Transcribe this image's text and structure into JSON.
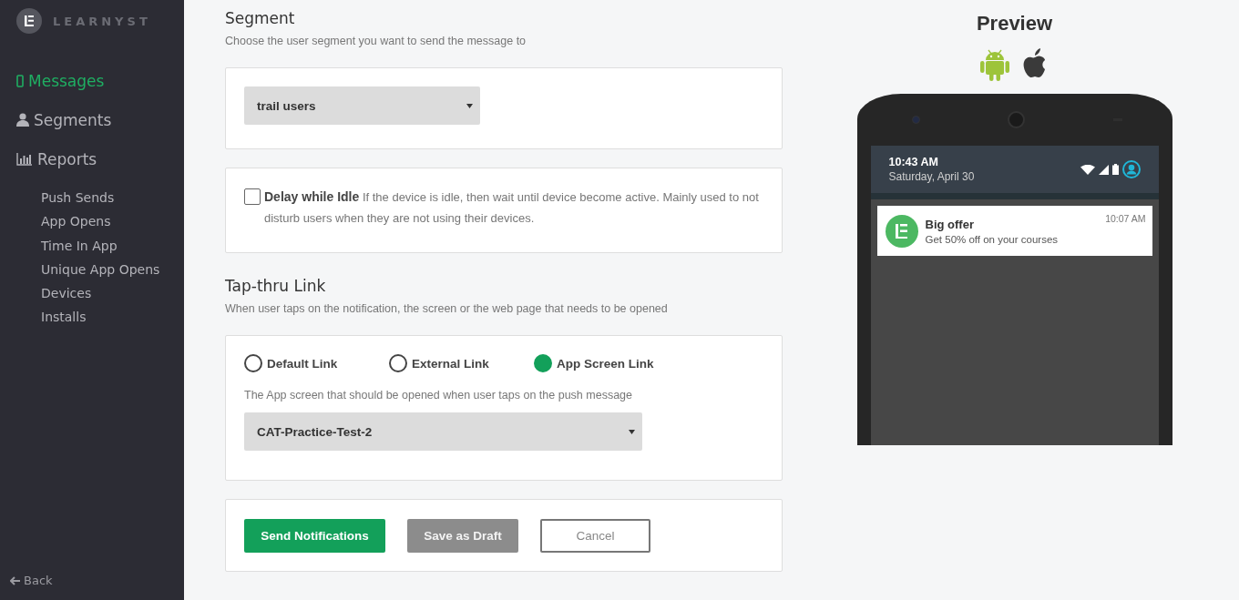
{
  "sidebar": {
    "logo": "LEARNYST",
    "items": [
      {
        "label": "Messages",
        "kind": "phone",
        "selected": true
      },
      {
        "label": "Segments",
        "kind": "user",
        "selected": false
      },
      {
        "label": "Reports",
        "kind": "chart",
        "selected": false
      }
    ],
    "sub_items": [
      "Push Sends",
      "App Opens",
      "Time In App",
      "Unique App Opens",
      "Devices",
      "Installs"
    ],
    "back": "Back"
  },
  "segment": {
    "title": "Segment",
    "hint": "Choose the user segment you want to send the message to",
    "value": "trail users"
  },
  "delay": {
    "checked": false,
    "text": "**Delay while Idle** If the device is idle, then wait until device become active. Mainly used to not disturb users when they are not using their devices."
  },
  "tap_thru": {
    "title": "Tap-thru Link",
    "hint": "When user taps on the notification, the screen or the web page that needs to be opened",
    "options": [
      {
        "label": "Default Link",
        "selected": false
      },
      {
        "label": "External Link",
        "selected": false
      },
      {
        "label": "App Screen Link",
        "selected": true
      }
    ],
    "screen_hint": "The App screen that should be opened when user taps on the push message",
    "screen_value": "CAT-Practice-Test-2"
  },
  "buttons": [
    {
      "label": "Send Notifications",
      "kind": "primary"
    },
    {
      "label": "Save as Draft",
      "kind": "secondary"
    },
    {
      "label": "Cancel",
      "kind": "outline"
    }
  ],
  "preview": {
    "title": "Preview",
    "time": "10:43 AM",
    "date": "Saturday, April 30",
    "notification": {
      "title": "Big offer",
      "body": "Get 50% off on your courses",
      "time": "10:07 AM"
    }
  }
}
